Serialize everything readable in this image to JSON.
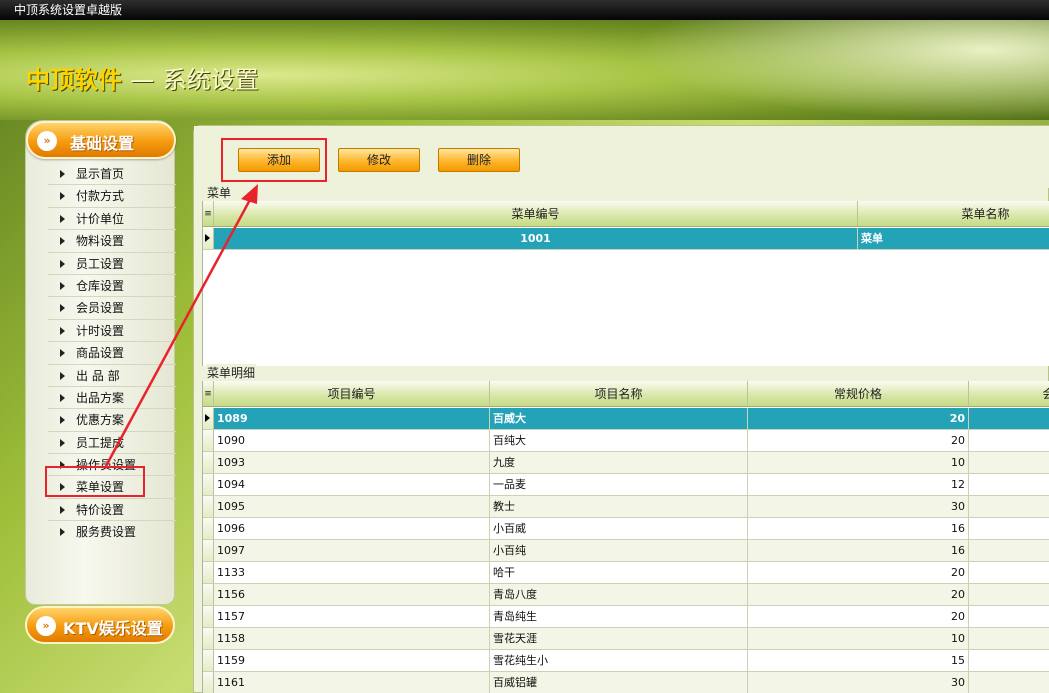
{
  "window": {
    "title": "中顶系统设置卓越版"
  },
  "header": {
    "brand": "中顶软件",
    "dash": "—",
    "subtitle": "系统设置"
  },
  "sidebar": {
    "section1": "基础设置",
    "section2": "KTV娱乐设置",
    "items": [
      "显示首页",
      "付款方式",
      "计价单位",
      "物料设置",
      "员工设置",
      "仓库设置",
      "会员设置",
      "计时设置",
      "商品设置",
      "出 品 部",
      "出品方案",
      "优惠方案",
      "员工提成",
      "操作员设置",
      "菜单设置",
      "特价设置",
      "服务费设置"
    ]
  },
  "toolbar": {
    "add": "添加",
    "edit": "修改",
    "delete": "删除"
  },
  "menu_grid": {
    "label": "菜单",
    "headers": [
      "菜单编号",
      "菜单名称"
    ],
    "rows": [
      {
        "code": "1001",
        "name": "菜单"
      }
    ]
  },
  "detail_grid": {
    "label": "菜单明细",
    "headers": [
      "项目编号",
      "项目名称",
      "常规价格",
      "会"
    ],
    "rows": [
      {
        "code": "1089",
        "name": "百威大",
        "price": "20"
      },
      {
        "code": "1090",
        "name": "百纯大",
        "price": "20"
      },
      {
        "code": "1093",
        "name": "九度",
        "price": "10"
      },
      {
        "code": "1094",
        "name": "一品麦",
        "price": "12"
      },
      {
        "code": "1095",
        "name": "教士",
        "price": "30"
      },
      {
        "code": "1096",
        "name": "小百威",
        "price": "16"
      },
      {
        "code": "1097",
        "name": "小百纯",
        "price": "16"
      },
      {
        "code": "1133",
        "name": "哈干",
        "price": "20"
      },
      {
        "code": "1156",
        "name": "青岛八度",
        "price": "20"
      },
      {
        "code": "1157",
        "name": "青岛纯生",
        "price": "20"
      },
      {
        "code": "1158",
        "name": "雪花天涯",
        "price": "10"
      },
      {
        "code": "1159",
        "name": "雪花纯生小",
        "price": "15"
      },
      {
        "code": "1161",
        "name": "百威铝罐",
        "price": "30"
      }
    ]
  },
  "colors": {
    "selection": "#23a2b8",
    "annotation": "#e8232b",
    "accent": "#f59b10"
  }
}
